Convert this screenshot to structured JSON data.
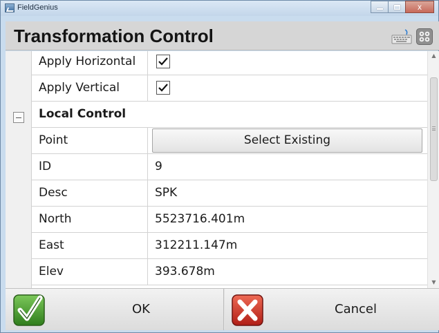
{
  "window": {
    "title": "FieldGenius",
    "close_glyph": "x"
  },
  "header": {
    "title": "Transformation Control",
    "icons": [
      "keyboard-icon",
      "grid-icon"
    ]
  },
  "rows": [
    {
      "label": "Apply Horizontal",
      "type": "checkbox",
      "checked": true
    },
    {
      "label": "Apply Vertical",
      "type": "checkbox",
      "checked": true
    },
    {
      "label": "Local Control",
      "type": "section",
      "collapsed": false
    },
    {
      "label": "Point",
      "type": "button",
      "value": "Select Existing"
    },
    {
      "label": "ID",
      "type": "text",
      "value": "9"
    },
    {
      "label": "Desc",
      "type": "text",
      "value": "SPK"
    },
    {
      "label": "North",
      "type": "text",
      "value": "5523716.401m"
    },
    {
      "label": "East",
      "type": "text",
      "value": "312211.147m"
    },
    {
      "label": "Elev",
      "type": "text",
      "value": "393.678m"
    }
  ],
  "footer": {
    "ok_label": "OK",
    "cancel_label": "Cancel"
  },
  "colors": {
    "ok_green": "#3f9b2a",
    "cancel_red": "#c8281e",
    "header_bg": "#d6d6d6",
    "frame_blue": "#c9dcee"
  }
}
